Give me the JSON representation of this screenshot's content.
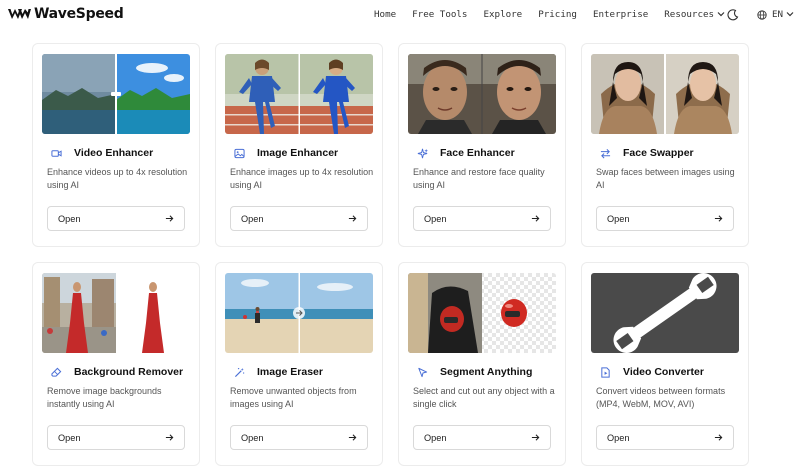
{
  "brand": {
    "name": "WaveSpeed"
  },
  "nav": {
    "links": [
      "Home",
      "Free Tools",
      "Explore",
      "Pricing",
      "Enterprise",
      "Resources"
    ],
    "language": "EN"
  },
  "colors": {
    "accent": "#3b6fd8",
    "icon": "#4a6fd6"
  },
  "open_label": "Open",
  "tools": [
    {
      "title": "Video Enhancer",
      "icon": "video-camera-icon",
      "desc": "Enhance videos up to 4x resolution using AI"
    },
    {
      "title": "Image Enhancer",
      "icon": "image-icon",
      "desc": "Enhance images up to 4x resolution using AI"
    },
    {
      "title": "Face Enhancer",
      "icon": "sparkles-icon",
      "desc": "Enhance and restore face quality using AI"
    },
    {
      "title": "Face Swapper",
      "icon": "swap-arrows-icon",
      "desc": "Swap faces between images using AI"
    },
    {
      "title": "Background Remover",
      "icon": "eraser-icon",
      "desc": "Remove image backgrounds instantly using AI"
    },
    {
      "title": "Image Eraser",
      "icon": "magic-wand-icon",
      "desc": "Remove unwanted objects from images using AI"
    },
    {
      "title": "Segment Anything",
      "icon": "cursor-pointer-icon",
      "desc": "Select and cut out any object with a single click"
    },
    {
      "title": "Video Converter",
      "icon": "file-video-icon",
      "desc": "Convert videos between formats (MP4, WebM, MOV, AVI)"
    }
  ]
}
